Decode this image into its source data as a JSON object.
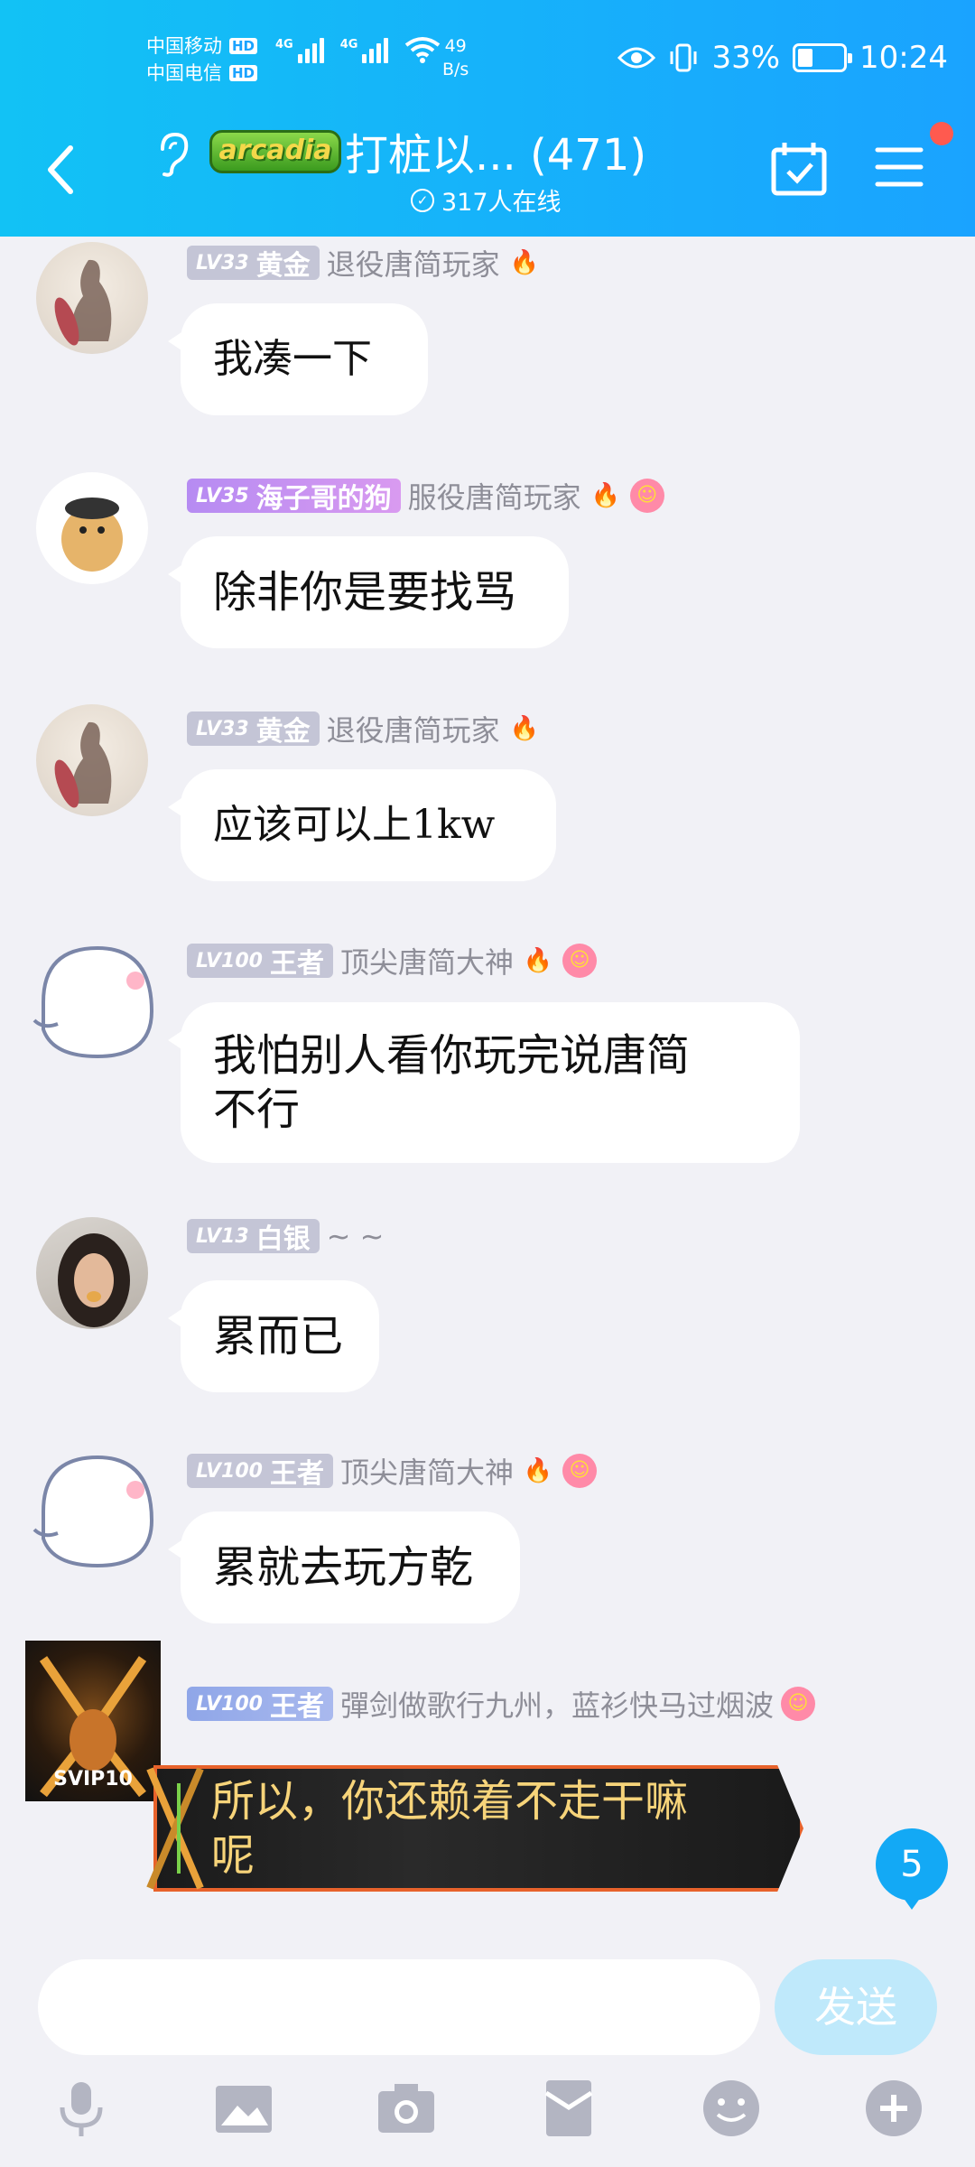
{
  "status_bar": {
    "carrier_1": "中国移动",
    "carrier_2": "中国电信",
    "hd_1": "HD",
    "hd_2": "HD",
    "net_1": "4G",
    "net_2": "4G",
    "speed_value": "49",
    "speed_unit": "B/s",
    "battery": "33%",
    "battery_level": 0.33,
    "time": "10:24"
  },
  "header": {
    "logo_text": "arcadia",
    "title": "打桩以... (471)",
    "online": "317人在线"
  },
  "messages": [
    {
      "level": "LV33",
      "rank": "黄金",
      "title": "退役唐简玩家",
      "text": "我凑一下"
    },
    {
      "level": "LV35",
      "rank": "海子哥的狗",
      "title": "服役唐简玩家",
      "text": "除非你是要找骂"
    },
    {
      "level": "LV33",
      "rank": "黄金",
      "title": "退役唐简玩家",
      "text": "应该可以上1kw"
    },
    {
      "level": "LV100",
      "rank": "王者",
      "title": "顶尖唐简大神",
      "text_line1": "我怕别人看你玩完说唐简",
      "text_line2": "不行"
    },
    {
      "level": "LV13",
      "rank": "白银",
      "title": "~ ~",
      "text": "累而已"
    },
    {
      "level": "LV100",
      "rank": "王者",
      "title": "顶尖唐简大神",
      "text": "累就去玩方乾"
    },
    {
      "level": "LV100",
      "rank": "王者",
      "title": "彈剑做歌行九州，蓝衫快马过烟波",
      "text_line1": "所以，你还赖着不走干嘛",
      "text_line2": "呢",
      "avatar_badge": "SVIP10"
    }
  ],
  "unread_count": "5",
  "composer": {
    "placeholder": "",
    "send_label": "发送"
  },
  "colors": {
    "header": "#1aa3ff",
    "background": "#f1f1f6",
    "send_button": "#bfe9fb"
  }
}
